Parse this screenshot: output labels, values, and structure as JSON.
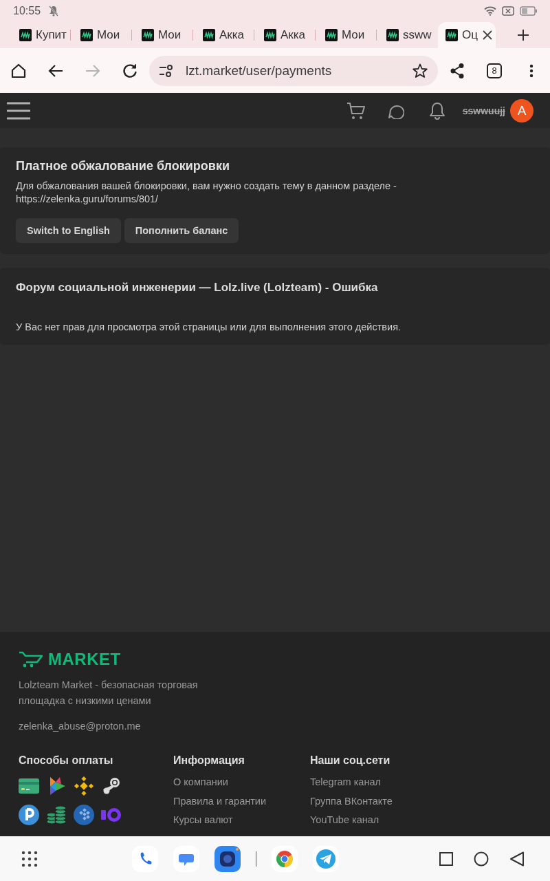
{
  "status_bar": {
    "time": "10:55"
  },
  "browser_tabs": [
    {
      "title": "Купит",
      "selected": false
    },
    {
      "title": "Мои",
      "selected": false
    },
    {
      "title": "Мои",
      "selected": false
    },
    {
      "title": "Акка",
      "selected": false
    },
    {
      "title": "Акка",
      "selected": false
    },
    {
      "title": "Мои",
      "selected": false
    },
    {
      "title": "ssww",
      "selected": false
    },
    {
      "title": "Оц",
      "selected": true
    }
  ],
  "toolbar": {
    "forward_disabled": true,
    "url": "lzt.market/user/payments",
    "tab_count": "8"
  },
  "site_header": {
    "username": "sswwuujj",
    "username_struck": true,
    "avatar_letter": "A"
  },
  "notice": {
    "title": "Платное обжалование блокировки",
    "text": "Для обжалования вашей блокировки, вам нужно создать тему в данном разделе - https://zelenka.guru/forums/801/",
    "buttons": [
      "Switch to English",
      "Пополнить баланс"
    ]
  },
  "error": {
    "title": "Форум социальной инженерии — Lolz.live (Lolzteam) - Ошибка",
    "message": "У Вас нет прав для просмотра этой страницы или для выполнения этого действия."
  },
  "footer": {
    "logo": "MARKET",
    "description": "Lolzteam Market - безопасная торговая площадка с низкими ценами",
    "email": "zelenka_abuse@proton.me",
    "columns": [
      {
        "heading": "Способы оплаты",
        "kind": "icons"
      },
      {
        "heading": "Информация",
        "kind": "links",
        "links": [
          "О компании",
          "Правила и гарантии",
          "Курсы валют"
        ]
      },
      {
        "heading": "Наши соц.сети",
        "kind": "links",
        "links": [
          "Telegram канал",
          "Группа ВКонтакте",
          "YouTube канал"
        ]
      }
    ]
  }
}
